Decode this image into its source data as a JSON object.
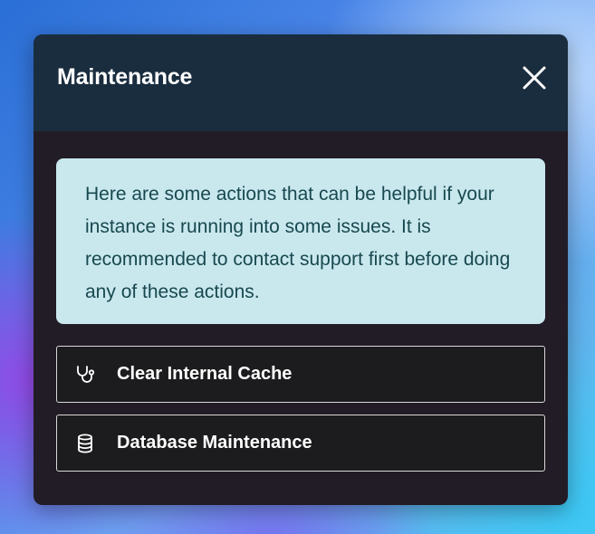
{
  "modal": {
    "title": "Maintenance",
    "close_icon": "close-icon",
    "info_text": "Here are some actions that can be helpful if your instance is running into some issues. It is recommended to contact support first before doing any of these actions.",
    "actions": [
      {
        "label": "Clear Internal Cache",
        "icon": "stethoscope-icon"
      },
      {
        "label": "Database Maintenance",
        "icon": "database-icon"
      }
    ]
  },
  "colors": {
    "header_bg": "#1a2d3f",
    "body_bg": "#221c26",
    "info_bg": "#c9e8ee",
    "info_text": "#18484f",
    "button_bg": "#1c1c1e",
    "button_border": "#d8d8d8"
  }
}
